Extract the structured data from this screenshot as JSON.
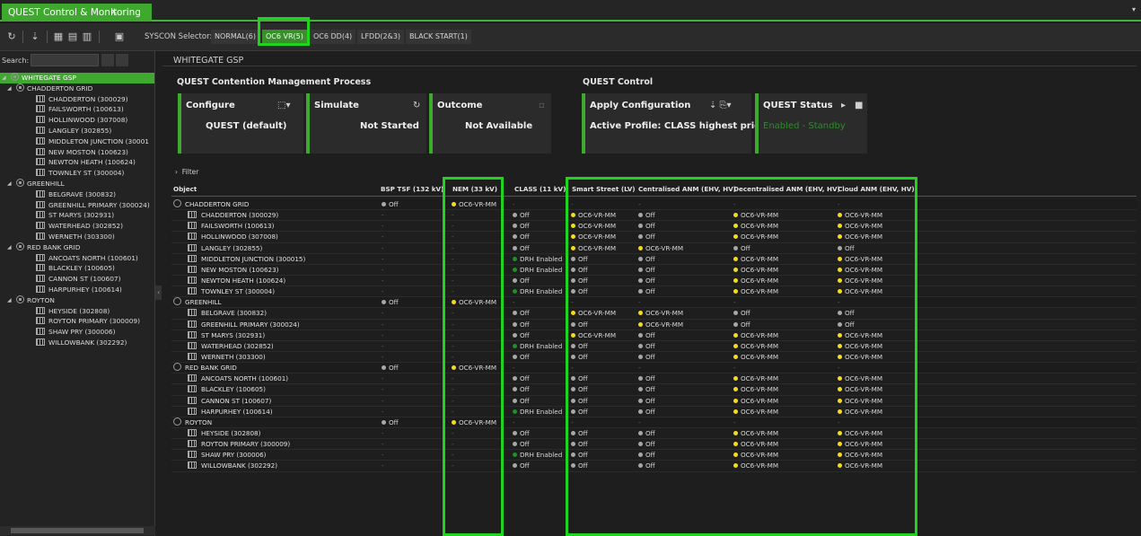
{
  "window": {
    "tab_title": "QUEST Control & Monitoring",
    "tab_close": "×",
    "menu_caret": "▾"
  },
  "toolbar": {
    "syscon_label": "SYSCON Selector:",
    "syscon_options": [
      "NORMAL(6)",
      "OC6 VR(5)",
      "OC6 DD(4)",
      "LFDD(2&3)",
      "BLACK START(1)"
    ],
    "active_option": "OC6 VR(5)"
  },
  "sidebar": {
    "search_label": "Search:",
    "search_value": "",
    "tree": [
      {
        "label": "WHITEGATE GSP",
        "level": 0,
        "type": "grid",
        "selected": true,
        "expanded": true
      },
      {
        "label": "CHADDERTON GRID",
        "level": 1,
        "type": "grid",
        "expanded": true
      },
      {
        "label": "CHADDERTON (300029)",
        "level": 2,
        "type": "sub"
      },
      {
        "label": "FAILSWORTH (100613)",
        "level": 2,
        "type": "sub"
      },
      {
        "label": "HOLLINWOOD (307008)",
        "level": 2,
        "type": "sub"
      },
      {
        "label": "LANGLEY (302855)",
        "level": 2,
        "type": "sub"
      },
      {
        "label": "MIDDLETON JUNCTION (30001",
        "level": 2,
        "type": "sub"
      },
      {
        "label": "NEW MOSTON (100623)",
        "level": 2,
        "type": "sub"
      },
      {
        "label": "NEWTON HEATH (100624)",
        "level": 2,
        "type": "sub"
      },
      {
        "label": "TOWNLEY ST (300004)",
        "level": 2,
        "type": "sub"
      },
      {
        "label": "GREENHILL",
        "level": 1,
        "type": "grid",
        "expanded": true
      },
      {
        "label": "BELGRAVE (300832)",
        "level": 2,
        "type": "sub"
      },
      {
        "label": "GREENHILL PRIMARY (300024)",
        "level": 2,
        "type": "sub"
      },
      {
        "label": "ST MARYS (302931)",
        "level": 2,
        "type": "sub"
      },
      {
        "label": "WATERHEAD (302852)",
        "level": 2,
        "type": "sub"
      },
      {
        "label": "WERNETH (303300)",
        "level": 2,
        "type": "sub"
      },
      {
        "label": "RED BANK GRID",
        "level": 1,
        "type": "grid",
        "expanded": true
      },
      {
        "label": "ANCOATS NORTH (100601)",
        "level": 2,
        "type": "sub"
      },
      {
        "label": "BLACKLEY (100605)",
        "level": 2,
        "type": "sub"
      },
      {
        "label": "CANNON ST (100607)",
        "level": 2,
        "type": "sub"
      },
      {
        "label": "HARPURHEY (100614)",
        "level": 2,
        "type": "sub"
      },
      {
        "label": "ROYTON",
        "level": 1,
        "type": "grid",
        "expanded": true
      },
      {
        "label": "HEYSIDE (302808)",
        "level": 2,
        "type": "sub"
      },
      {
        "label": "ROYTON PRIMARY (300009)",
        "level": 2,
        "type": "sub"
      },
      {
        "label": "SHAW PRY (300006)",
        "level": 2,
        "type": "sub"
      },
      {
        "label": "WILLOWBANK (302292)",
        "level": 2,
        "type": "sub"
      }
    ]
  },
  "main": {
    "gsp_title": "WHITEGATE GSP",
    "contention_title": "QUEST Contention Management Process",
    "control_title": "QUEST Control",
    "cards": {
      "configure": {
        "title": "Configure",
        "value": "QUEST (default)"
      },
      "simulate": {
        "title": "Simulate",
        "value": "Not Started"
      },
      "outcome": {
        "title": "Outcome",
        "value": "Not Available"
      },
      "apply": {
        "title": "Apply Configuration",
        "value": "Active Profile: CLASS highest priority"
      },
      "status": {
        "title": "QUEST Status",
        "value": "Enabled - Standby"
      }
    },
    "filter_label": "Filter",
    "columns": [
      "Object",
      "BSP TSF (132 kV)",
      "NEM (33 kV)",
      "CLASS (11 kV)",
      "Smart Street (LV)",
      "Centralised ANM (EHV, HV)",
      "Decentralised ANM (EHV, HV)",
      "Cloud ANM (EHV, HV)"
    ],
    "colors": {
      "accent": "#3ea92e",
      "highlight": "#1fd31f",
      "dot_yellow": "#f3dc1d",
      "dot_grey": "#a8a8a8",
      "dot_green": "#1f8f2e"
    },
    "rows": [
      {
        "object": "CHADDERTON GRID",
        "group": true,
        "bsp": "Off",
        "nem": "OC6-VR-MM",
        "class": "-",
        "ss": "-",
        "cen": "-",
        "dec": "-",
        "cloud": "-"
      },
      {
        "object": "CHADDERTON (300029)",
        "group": false,
        "bsp": "-",
        "nem": "-",
        "class": "Off",
        "ss": "OC6-VR-MM",
        "cen": "Off",
        "dec": "OC6-VR-MM",
        "cloud": "OC6-VR-MM"
      },
      {
        "object": "FAILSWORTH (100613)",
        "group": false,
        "bsp": "-",
        "nem": "-",
        "class": "Off",
        "ss": "OC6-VR-MM",
        "cen": "Off",
        "dec": "OC6-VR-MM",
        "cloud": "OC6-VR-MM"
      },
      {
        "object": "HOLLINWOOD (307008)",
        "group": false,
        "bsp": "-",
        "nem": "-",
        "class": "Off",
        "ss": "OC6-VR-MM",
        "cen": "Off",
        "dec": "OC6-VR-MM",
        "cloud": "OC6-VR-MM"
      },
      {
        "object": "LANGLEY (302855)",
        "group": false,
        "bsp": "-",
        "nem": "-",
        "class": "Off",
        "ss": "OC6-VR-MM",
        "cen": "OC6-VR-MM",
        "dec": "Off",
        "cloud": "Off"
      },
      {
        "object": "MIDDLETON JUNCTION (300015)",
        "group": false,
        "bsp": "-",
        "nem": "-",
        "class": "DRH Enabled",
        "ss": "Off",
        "cen": "Off",
        "dec": "OC6-VR-MM",
        "cloud": "OC6-VR-MM"
      },
      {
        "object": "NEW MOSTON (100623)",
        "group": false,
        "bsp": "-",
        "nem": "-",
        "class": "DRH Enabled",
        "ss": "Off",
        "cen": "Off",
        "dec": "OC6-VR-MM",
        "cloud": "OC6-VR-MM"
      },
      {
        "object": "NEWTON HEATH (100624)",
        "group": false,
        "bsp": "-",
        "nem": "-",
        "class": "Off",
        "ss": "Off",
        "cen": "Off",
        "dec": "OC6-VR-MM",
        "cloud": "OC6-VR-MM"
      },
      {
        "object": "TOWNLEY ST (300004)",
        "group": false,
        "bsp": "-",
        "nem": "-",
        "class": "DRH Enabled",
        "ss": "Off",
        "cen": "Off",
        "dec": "OC6-VR-MM",
        "cloud": "OC6-VR-MM"
      },
      {
        "object": "GREENHILL",
        "group": true,
        "bsp": "Off",
        "nem": "OC6-VR-MM",
        "class": "-",
        "ss": "-",
        "cen": "-",
        "dec": "-",
        "cloud": "-"
      },
      {
        "object": "BELGRAVE (300832)",
        "group": false,
        "bsp": "-",
        "nem": "-",
        "class": "Off",
        "ss": "OC6-VR-MM",
        "cen": "OC6-VR-MM",
        "dec": "Off",
        "cloud": "Off"
      },
      {
        "object": "GREENHILL PRIMARY (300024)",
        "group": false,
        "bsp": "-",
        "nem": "-",
        "class": "Off",
        "ss": "Off",
        "cen": "OC6-VR-MM",
        "dec": "Off",
        "cloud": "Off"
      },
      {
        "object": "ST MARYS (302931)",
        "group": false,
        "bsp": "-",
        "nem": "-",
        "class": "Off",
        "ss": "OC6-VR-MM",
        "cen": "Off",
        "dec": "OC6-VR-MM",
        "cloud": "OC6-VR-MM"
      },
      {
        "object": "WATERHEAD (302852)",
        "group": false,
        "bsp": "-",
        "nem": "-",
        "class": "DRH Enabled",
        "ss": "Off",
        "cen": "Off",
        "dec": "OC6-VR-MM",
        "cloud": "OC6-VR-MM"
      },
      {
        "object": "WERNETH (303300)",
        "group": false,
        "bsp": "-",
        "nem": "-",
        "class": "Off",
        "ss": "Off",
        "cen": "Off",
        "dec": "OC6-VR-MM",
        "cloud": "OC6-VR-MM"
      },
      {
        "object": "RED BANK GRID",
        "group": true,
        "bsp": "Off",
        "nem": "OC6-VR-MM",
        "class": "-",
        "ss": "-",
        "cen": "-",
        "dec": "-",
        "cloud": "-"
      },
      {
        "object": "ANCOATS NORTH (100601)",
        "group": false,
        "bsp": "-",
        "nem": "-",
        "class": "Off",
        "ss": "Off",
        "cen": "Off",
        "dec": "OC6-VR-MM",
        "cloud": "OC6-VR-MM"
      },
      {
        "object": "BLACKLEY (100605)",
        "group": false,
        "bsp": "-",
        "nem": "-",
        "class": "Off",
        "ss": "Off",
        "cen": "Off",
        "dec": "OC6-VR-MM",
        "cloud": "OC6-VR-MM"
      },
      {
        "object": "CANNON ST (100607)",
        "group": false,
        "bsp": "-",
        "nem": "-",
        "class": "Off",
        "ss": "Off",
        "cen": "Off",
        "dec": "OC6-VR-MM",
        "cloud": "OC6-VR-MM"
      },
      {
        "object": "HARPURHEY (100614)",
        "group": false,
        "bsp": "-",
        "nem": "-",
        "class": "DRH Enabled",
        "ss": "Off",
        "cen": "Off",
        "dec": "OC6-VR-MM",
        "cloud": "OC6-VR-MM"
      },
      {
        "object": "ROYTON",
        "group": true,
        "bsp": "Off",
        "nem": "OC6-VR-MM",
        "class": "-",
        "ss": "-",
        "cen": "-",
        "dec": "-",
        "cloud": "-"
      },
      {
        "object": "HEYSIDE (302808)",
        "group": false,
        "bsp": "-",
        "nem": "-",
        "class": "Off",
        "ss": "Off",
        "cen": "Off",
        "dec": "OC6-VR-MM",
        "cloud": "OC6-VR-MM"
      },
      {
        "object": "ROYTON PRIMARY (300009)",
        "group": false,
        "bsp": "-",
        "nem": "-",
        "class": "Off",
        "ss": "Off",
        "cen": "Off",
        "dec": "OC6-VR-MM",
        "cloud": "OC6-VR-MM"
      },
      {
        "object": "SHAW PRY (300006)",
        "group": false,
        "bsp": "-",
        "nem": "-",
        "class": "DRH Enabled",
        "ss": "Off",
        "cen": "Off",
        "dec": "OC6-VR-MM",
        "cloud": "OC6-VR-MM"
      },
      {
        "object": "WILLOWBANK (302292)",
        "group": false,
        "bsp": "-",
        "nem": "-",
        "class": "Off",
        "ss": "Off",
        "cen": "Off",
        "dec": "OC6-VR-MM",
        "cloud": "OC6-VR-MM"
      }
    ]
  }
}
